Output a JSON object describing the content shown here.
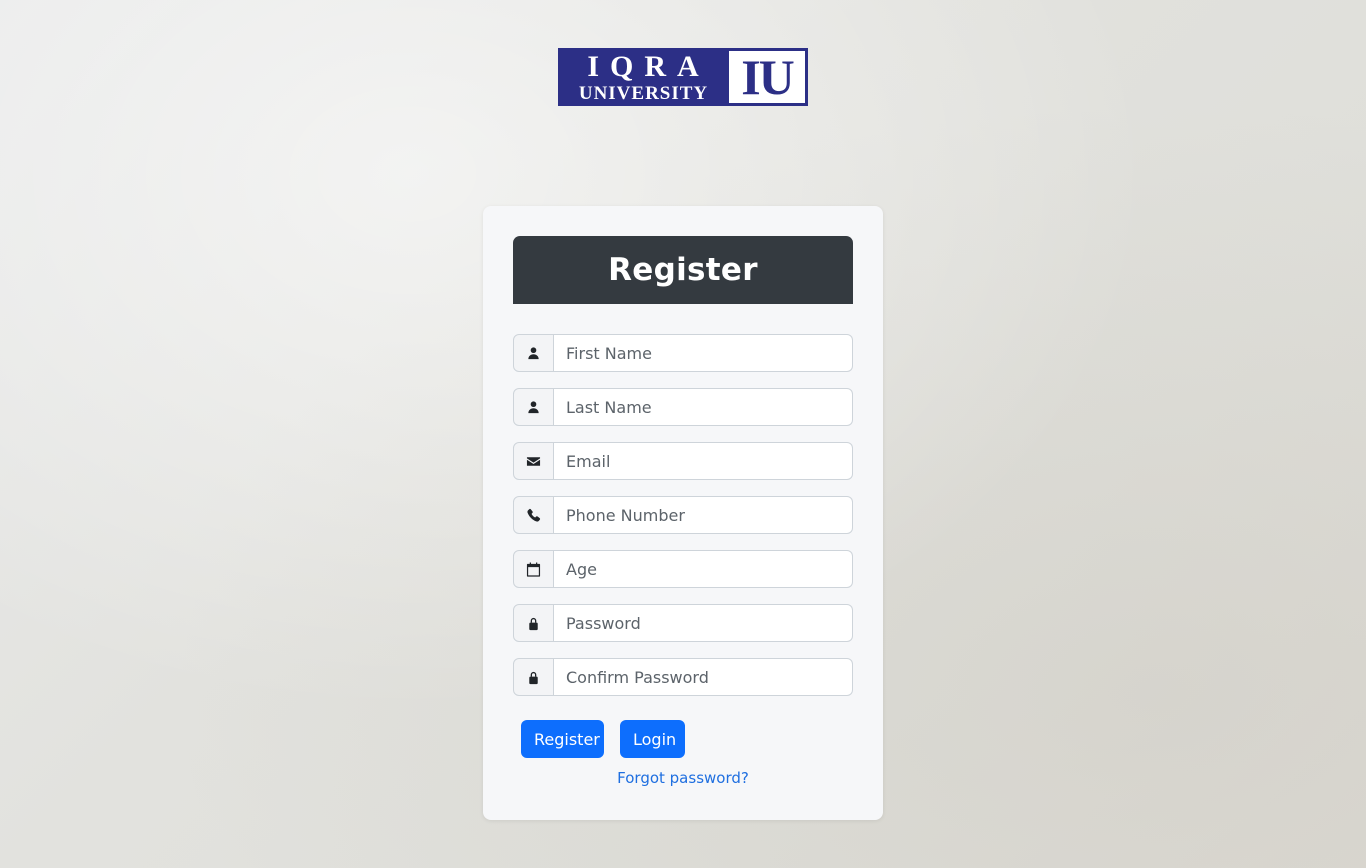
{
  "logo": {
    "line1": "IQRA",
    "line2": "UNIVERSITY",
    "mark": "IU"
  },
  "form": {
    "title": "Register",
    "fields": [
      {
        "icon": "person-icon",
        "placeholder": "First Name",
        "value": ""
      },
      {
        "icon": "person-icon",
        "placeholder": "Last Name",
        "value": ""
      },
      {
        "icon": "envelope-icon",
        "placeholder": "Email",
        "value": ""
      },
      {
        "icon": "phone-icon",
        "placeholder": "Phone Number",
        "value": ""
      },
      {
        "icon": "calendar-icon",
        "placeholder": "Age",
        "value": ""
      },
      {
        "icon": "lock-icon",
        "placeholder": "Password",
        "value": ""
      },
      {
        "icon": "lock-icon",
        "placeholder": "Confirm Password",
        "value": ""
      }
    ],
    "register_label": "Register",
    "login_label": "Login",
    "forgot_label": "Forgot password?"
  },
  "colors": {
    "header_bg": "#343a40",
    "button_bg": "#0d6efd",
    "link": "#1f6fe0",
    "logo_bg": "#2c2f86"
  }
}
